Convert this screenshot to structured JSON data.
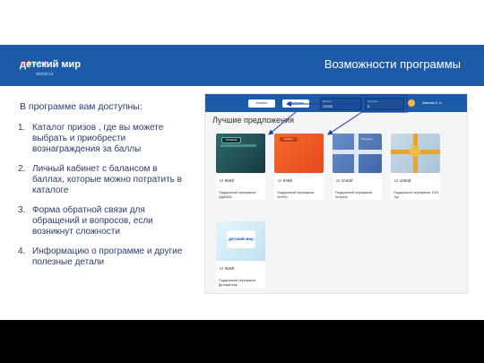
{
  "header": {
    "title": "Возможности программы",
    "logo_text": "детский мир",
    "logo_sub": "detmir.ru",
    "logo_dot_colors": [
      "#e8323a",
      "#f6a823",
      "#2bb673",
      "#1d5aa8",
      "#8e44ad"
    ]
  },
  "intro": "В программе вам доступны:",
  "features": [
    {
      "num": "1.",
      "text": "Каталог призов , где вы можете выбрать и приобрести вознаграждения за баллы"
    },
    {
      "num": "2.",
      "text": "Личный кабинет с балансом в баллах, которые можно потратить в каталоге"
    },
    {
      "num": "3.",
      "text": "Форма обратной связи для обращений и вопросов, если возникнут сложности"
    },
    {
      "num": "4.",
      "text": "Информацию о программе и другие полезные детали"
    }
  ],
  "screenshot": {
    "nav": {
      "catalog_label": "Каталог",
      "support_label": "Поддержка",
      "balance_label": "Баланс",
      "balance_value": "12000",
      "cart_label": "Корзина",
      "cart_value": "5",
      "user_name": "Иванова Л. А."
    },
    "offers_title": "Лучшие предложения",
    "cards": [
      {
        "price": "от 960₽",
        "name": "Подарочный сертификат АДАМАС",
        "tag": "ADAMAS"
      },
      {
        "price": "от 930₽",
        "name": "Подарочный сертификат ЛитРес",
        "tag": "ЛитРес"
      },
      {
        "price": "от 1040₽",
        "name": "Подарочный сертификат Летуаль",
        "tag": "Л'Этуаль"
      },
      {
        "price": "от 1000₽",
        "name": "Подарочный сертификат 1001 Тур",
        "tag": ""
      },
      {
        "price": "от 960₽",
        "name": "Подарочный сертификат Детский мир",
        "tag": "детский мир"
      }
    ]
  },
  "colors": {
    "brand_blue": "#1d5aa8",
    "text_dark_blue": "#2a3d6b",
    "callout_border": "#1f3da8"
  }
}
